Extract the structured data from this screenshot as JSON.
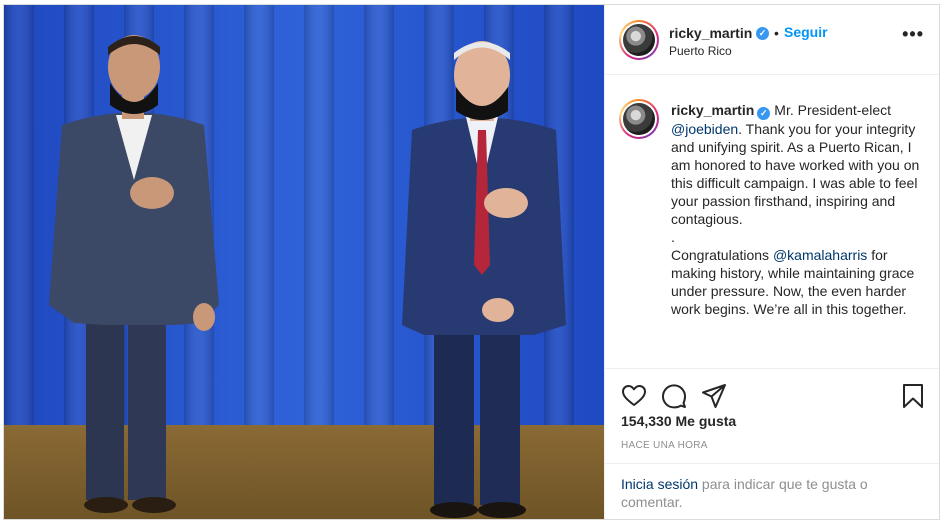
{
  "post": {
    "header": {
      "username": "ricky_martin",
      "verified_mark": "✓",
      "separator": "•",
      "follow_label": "Seguir",
      "location": "Puerto Rico",
      "more_label": "•••"
    },
    "caption": {
      "username": "ricky_martin",
      "verified_mark": "✓",
      "p1_start": "Mr. President-elect ",
      "p1_mention": "@joebiden",
      "p1_end": ". Thank you for your integrity and unifying spirit. As a Puerto Rican, I am honored to have worked with you on this difficult campaign. I was able to feel your passion firsthand, inspiring and contagious.",
      "dot": ".",
      "p2_start": "Congratulations ",
      "p2_mention": "@kamalaharris",
      "p2_end": " for making history, while maintaining grace under pressure. Now, the even harder work begins. We’re all in this together."
    },
    "actions": {
      "icons": [
        "heart-icon",
        "comment-icon",
        "share-icon",
        "bookmark-icon"
      ]
    },
    "likes": "154,330 Me gusta",
    "timestamp": "HACE UNA HORA",
    "login": {
      "link": "Inicia sesión",
      "rest": " para indicar que te gusta o comentar."
    }
  }
}
